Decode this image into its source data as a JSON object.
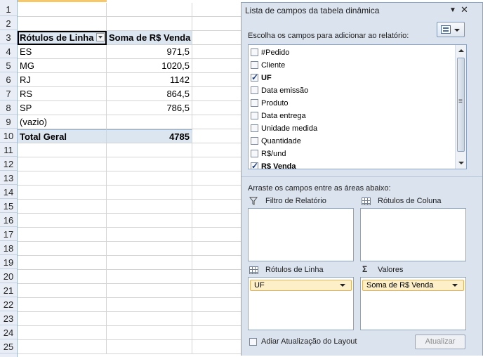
{
  "sheet": {
    "rows": [
      "1",
      "2",
      "3",
      "4",
      "5",
      "6",
      "7",
      "8",
      "9",
      "10",
      "11",
      "12",
      "13",
      "14",
      "15",
      "16",
      "17",
      "18",
      "19",
      "20",
      "21",
      "22",
      "23",
      "24",
      "25"
    ],
    "header": {
      "row_labels": "Rótulos de Linha",
      "sum_label": "Soma de R$ Venda"
    },
    "data": [
      {
        "label": "ES",
        "value": "971,5"
      },
      {
        "label": "MG",
        "value": "1020,5"
      },
      {
        "label": "RJ",
        "value": "1142"
      },
      {
        "label": "RS",
        "value": "864,5"
      },
      {
        "label": "SP",
        "value": "786,5"
      },
      {
        "label": "(vazio)",
        "value": ""
      }
    ],
    "total": {
      "label": "Total Geral",
      "value": "4785"
    }
  },
  "pane": {
    "title": "Lista de campos da tabela dinâmica",
    "choose_label": "Escolha os campos para adicionar ao relatório:",
    "fields": [
      {
        "label": "#Pedido",
        "checked": false
      },
      {
        "label": "Cliente",
        "checked": false
      },
      {
        "label": "UF",
        "checked": true
      },
      {
        "label": "Data emissão",
        "checked": false
      },
      {
        "label": "Produto",
        "checked": false
      },
      {
        "label": "Data entrega",
        "checked": false
      },
      {
        "label": "Unidade medida",
        "checked": false
      },
      {
        "label": "Quantidade",
        "checked": false
      },
      {
        "label": "R$/und",
        "checked": false
      },
      {
        "label": "R$ Venda",
        "checked": true
      }
    ],
    "drag_label": "Arraste os campos entre as áreas abaixo:",
    "areas": {
      "report_filter": "Filtro de Relatório",
      "column_labels": "Rótulos de Coluna",
      "row_labels": "Rótulos de Linha",
      "values": "Valores",
      "row_field": "UF",
      "value_field": "Soma de R$ Venda"
    },
    "defer_label": "Adiar Atualização do Layout",
    "update_button": "Atualizar",
    "icons": {
      "dropdown": "▼",
      "close": "✕",
      "filter": "filter-icon",
      "sigma": "Σ"
    }
  }
}
